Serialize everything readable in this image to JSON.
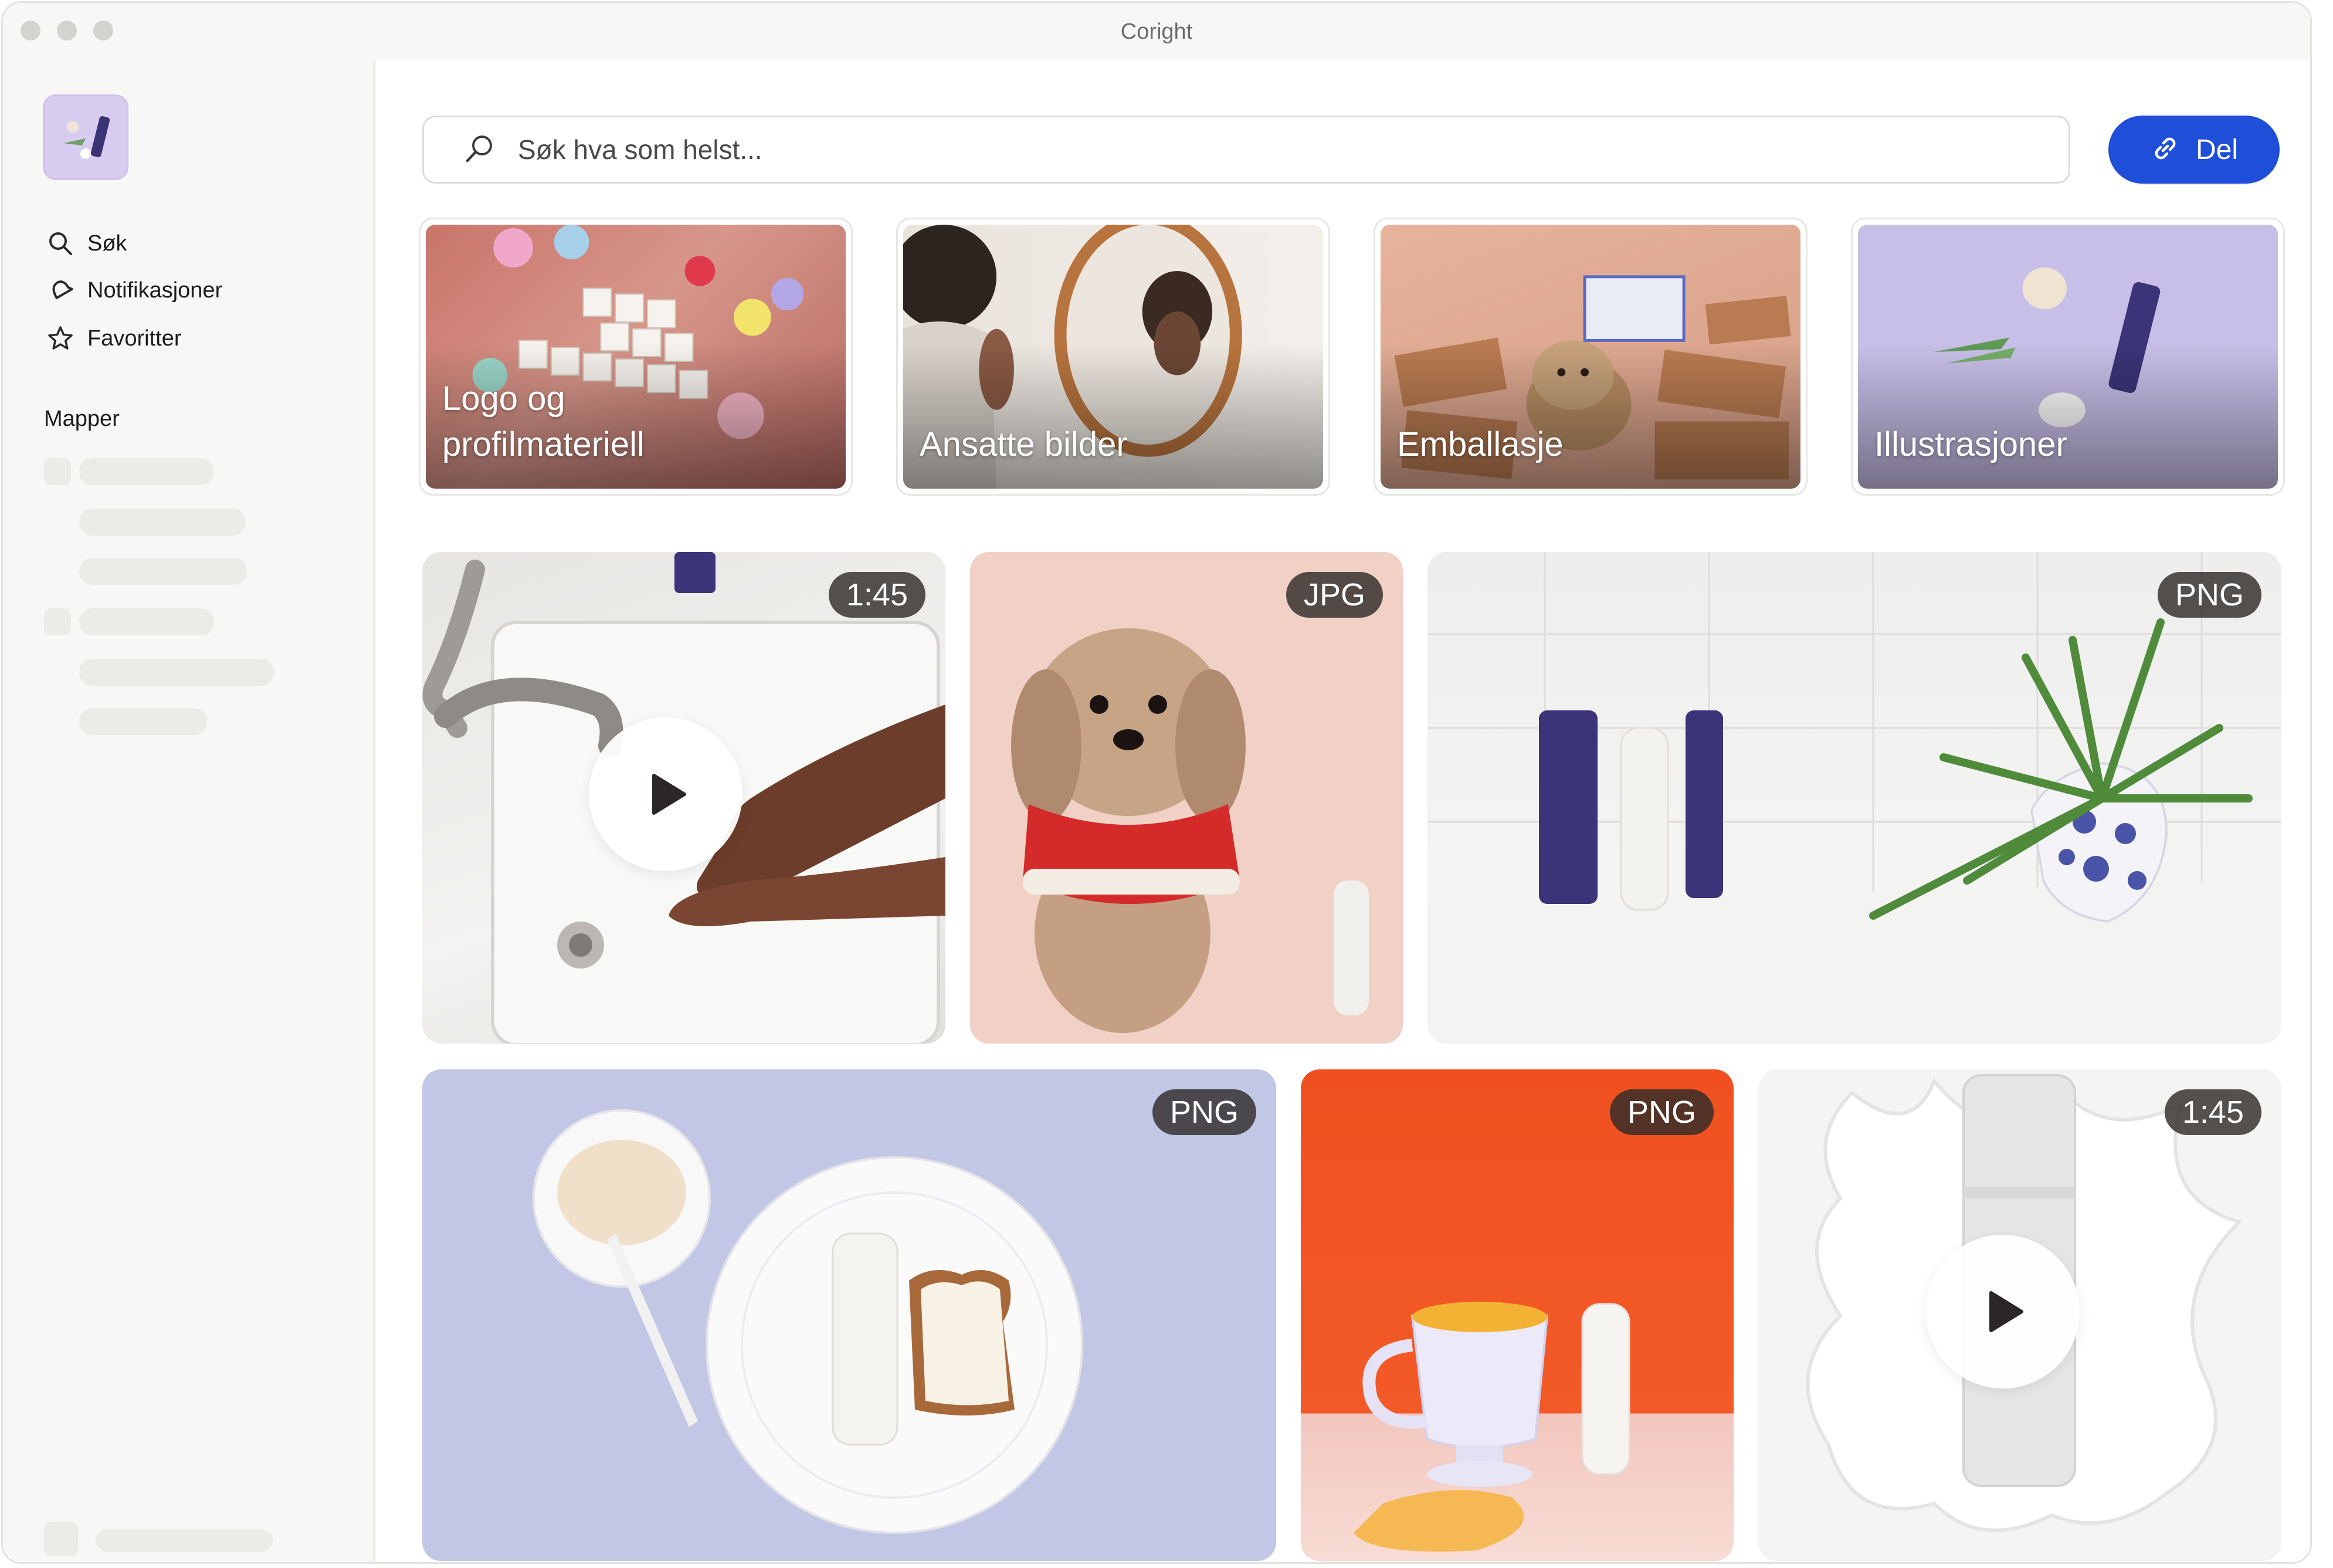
{
  "window": {
    "title": "Coright"
  },
  "sidebar": {
    "nav": [
      {
        "label": "Søk",
        "icon": "search-icon"
      },
      {
        "label": "Notifikasjoner",
        "icon": "bell-icon"
      },
      {
        "label": "Favoritter",
        "icon": "star-icon"
      }
    ],
    "section_title": "Mapper"
  },
  "search": {
    "placeholder": "Søk hva som helst..."
  },
  "share_button": {
    "label": "Del",
    "icon": "link-icon"
  },
  "categories": [
    {
      "title": "Logo og profilmateriell"
    },
    {
      "title": "Ansatte bilder"
    },
    {
      "title": "Emballasje"
    },
    {
      "title": "Illustrasjoner"
    }
  ],
  "media": [
    {
      "badge": "1:45",
      "type": "video",
      "subject": "hands-washing"
    },
    {
      "badge": "JPG",
      "type": "image",
      "subject": "dog-in-red-sweater"
    },
    {
      "badge": "PNG",
      "type": "image",
      "subject": "products-with-plant"
    },
    {
      "badge": "PNG",
      "type": "image",
      "subject": "toast-plate"
    },
    {
      "badge": "PNG",
      "type": "image",
      "subject": "mug-on-orange"
    },
    {
      "badge": "1:45",
      "type": "video",
      "subject": "bottle-splash"
    }
  ],
  "colors": {
    "accent": "#1f4fd8",
    "sidebar_bg": "#f7f7f5",
    "badge_bg": "#302c2a"
  }
}
